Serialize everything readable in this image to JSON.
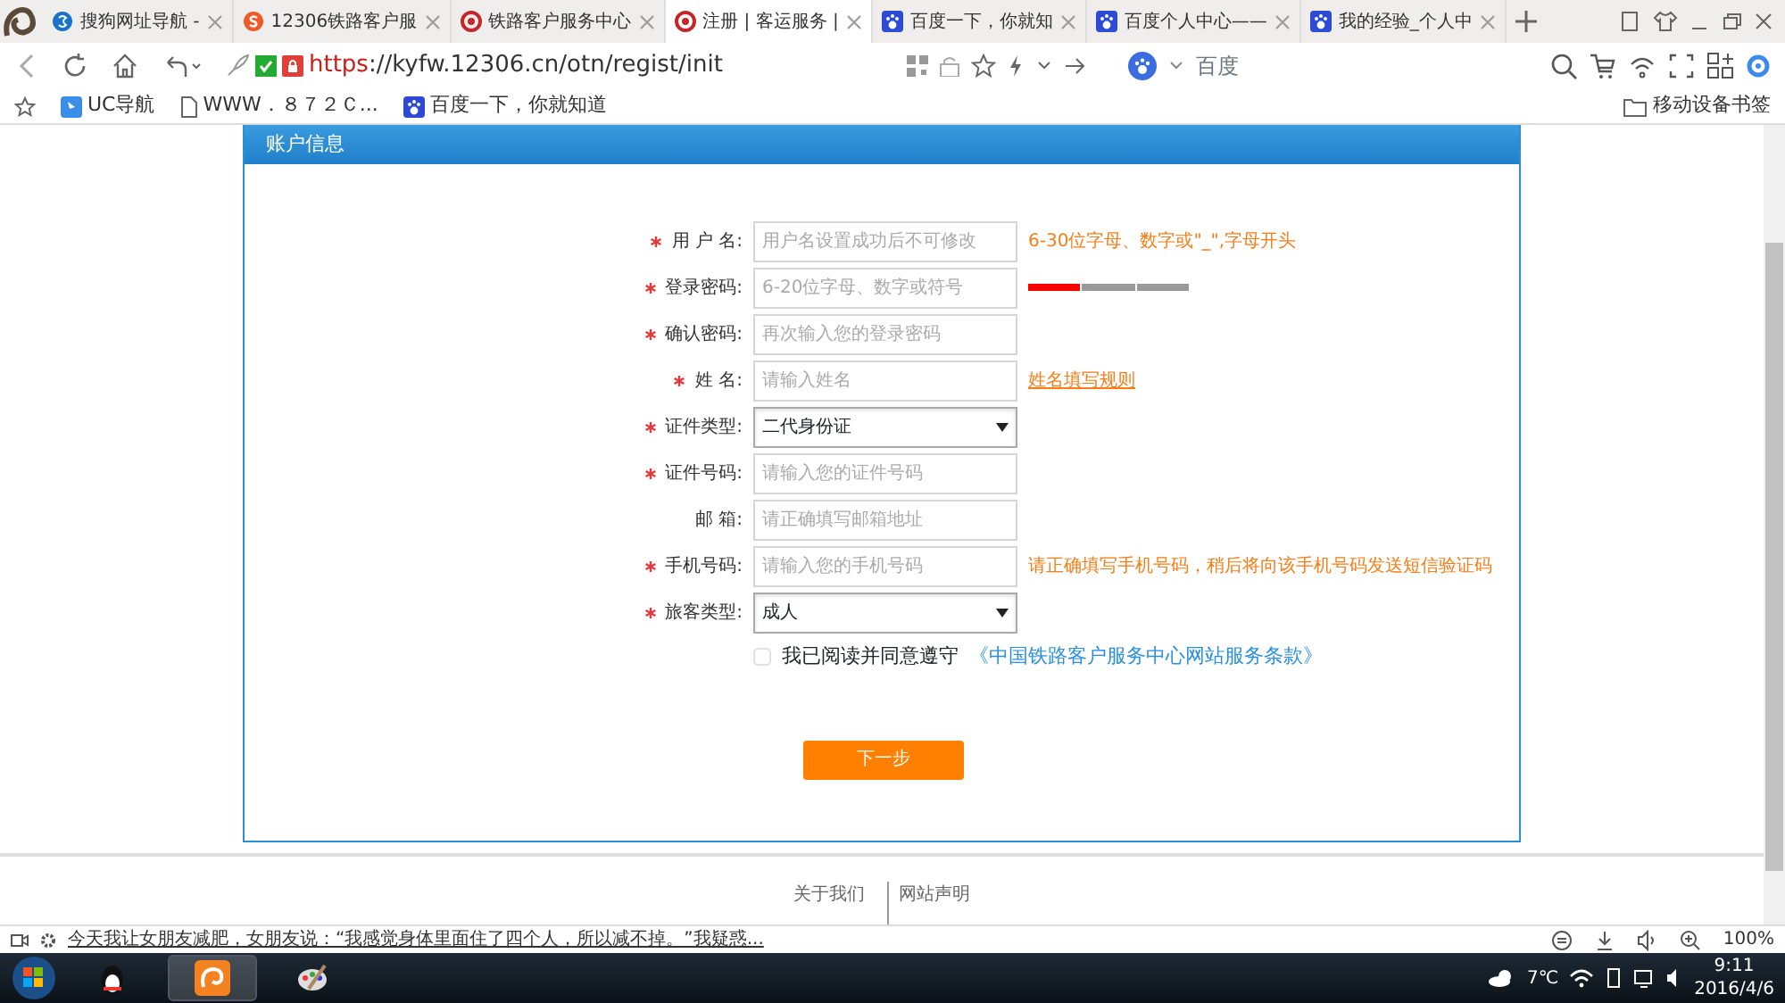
{
  "tabs": [
    {
      "label": "搜狗网址导航 - ",
      "selected": false
    },
    {
      "label": "12306铁路客户服",
      "selected": false
    },
    {
      "label": "铁路客户服务中心",
      "selected": false
    },
    {
      "label": "注册 | 客运服务 |",
      "selected": true
    },
    {
      "label": "百度一下，你就知",
      "selected": false
    },
    {
      "label": "百度个人中心——",
      "selected": false
    },
    {
      "label": "我的经验_个人中",
      "selected": false
    }
  ],
  "address": {
    "scheme": "https",
    "rest": "://kyfw.12306.cn/otn/regist/init"
  },
  "search_engine": "百度",
  "bookmarks": [
    {
      "label": "UC导航"
    },
    {
      "label": "WWW．８７２Ｃ..."
    },
    {
      "label": "百度一下，你就知道"
    }
  ],
  "mobile_bookmarks": "移动设备书签",
  "panel": {
    "title": "账户信息",
    "fields": [
      {
        "kind": "input",
        "required": true,
        "label": "用 户 名:",
        "placeholder": "用户名设置成功后不可修改",
        "hint": "6-30位字母、数字或\"_\",字母开头"
      },
      {
        "kind": "password",
        "required": true,
        "label": "登录密码:",
        "placeholder": "6-20位字母、数字或符号",
        "strength": {
          "level": 0.33
        }
      },
      {
        "kind": "input",
        "required": true,
        "label": "确认密码:",
        "placeholder": "再次输入您的登录密码"
      },
      {
        "kind": "input",
        "required": true,
        "label": "姓 名:",
        "placeholder": "请输入姓名",
        "link": "姓名填写规则"
      },
      {
        "kind": "select",
        "required": true,
        "label": "证件类型:",
        "value": "二代身份证"
      },
      {
        "kind": "input",
        "required": true,
        "label": "证件号码:",
        "placeholder": "请输入您的证件号码"
      },
      {
        "kind": "input",
        "required": false,
        "label": "邮 箱:",
        "placeholder": "请正确填写邮箱地址"
      },
      {
        "kind": "input",
        "required": true,
        "label": "手机号码:",
        "placeholder": "请输入您的手机号码",
        "hint": "请正确填写手机号码，稍后将向该手机号码发送短信验证码"
      },
      {
        "kind": "select",
        "required": true,
        "label": "旅客类型:",
        "value": "成人"
      }
    ],
    "agree": {
      "checked": false,
      "text": "我已阅读并同意遵守",
      "link": "《中国铁路客户服务中心网站服务条款》"
    },
    "submit": "下一步"
  },
  "footer_links": [
    "关于我们",
    "网站声明"
  ],
  "status_news": "今天我让女朋友减肥，女朋友说：“我感觉身体里面住了四个人，所以减不掉。”我疑惑...",
  "zoom": "100%",
  "tray": {
    "temp": "7℃",
    "time": "9:11",
    "date": "2016/4/6"
  }
}
